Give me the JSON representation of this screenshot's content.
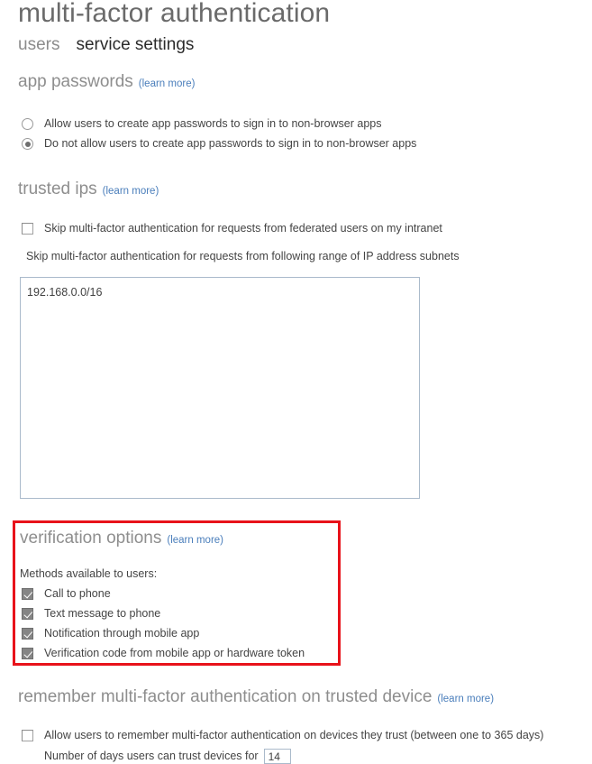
{
  "header": {
    "title": "multi-factor authentication",
    "tabs": [
      {
        "label": "users",
        "active": false
      },
      {
        "label": "service settings",
        "active": true
      }
    ]
  },
  "common": {
    "learn_more": "(learn more)"
  },
  "sections": {
    "app_passwords": {
      "heading": "app passwords",
      "learn_more": "(learn more)",
      "options": [
        {
          "label": "Allow users to create app passwords to sign in to non-browser apps",
          "selected": false
        },
        {
          "label": "Do not allow users to create app passwords to sign in to non-browser apps",
          "selected": true
        }
      ]
    },
    "trusted_ips": {
      "heading": "trusted ips",
      "learn_more": "(learn more)",
      "federated_checkbox": {
        "label": "Skip multi-factor authentication for requests from federated users on my intranet",
        "checked": false
      },
      "subnets_label": "Skip multi-factor authentication for requests from following range of IP address subnets",
      "subnets_value": "192.168.0.0/16",
      "subnets_placeholder": ""
    },
    "verification_options": {
      "heading": "verification options",
      "learn_more": "(learn more)",
      "methods_label": "Methods available to users:",
      "methods": [
        {
          "label": "Call to phone",
          "checked": true
        },
        {
          "label": "Text message to phone",
          "checked": true
        },
        {
          "label": "Notification through mobile app",
          "checked": true
        },
        {
          "label": "Verification code from mobile app or hardware token",
          "checked": true
        }
      ],
      "highlight_color": "#e8121a"
    },
    "remember_mfa": {
      "heading": "remember multi-factor authentication on trusted device",
      "learn_more": "(learn more)",
      "allow_checkbox": {
        "label": "Allow users to remember multi-factor authentication on devices they trust (between one to 365 days)",
        "checked": false
      },
      "days_label": "Number of days users can trust devices for",
      "days_value": "14"
    }
  },
  "colors": {
    "heading_grey": "#8e8e8e",
    "link_blue": "#4a7ebb",
    "title_grey": "#6a6a6a",
    "highlight_red": "#e8121a"
  }
}
